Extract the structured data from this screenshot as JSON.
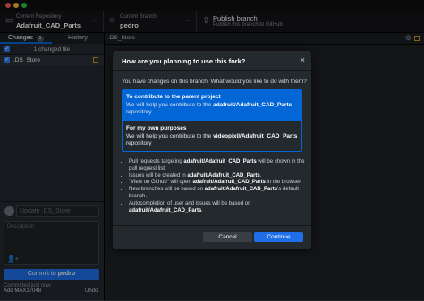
{
  "window": {
    "traffic_lights": [
      "#ff5f57",
      "#febc2e",
      "#28c840"
    ]
  },
  "toolbar": {
    "repo_label": "Current Repository",
    "repo_name": "Adafruit_CAD_Parts",
    "branch_label": "Current Branch",
    "branch_name": "pedro",
    "publish_label": "Publish branch",
    "publish_sub": "Publish this branch to GitHub"
  },
  "sidebar": {
    "tabs": [
      {
        "label": "Changes",
        "badge": "1"
      },
      {
        "label": "History"
      }
    ],
    "changes_count": "1 changed file",
    "files": [
      {
        "name": ".DS_Store",
        "status": "modified"
      }
    ],
    "commit": {
      "summary_placeholder": "Update .DS_Store",
      "description_placeholder": "Description",
      "commit_button_prefix": "Commit to ",
      "commit_branch": "pedro",
      "last_commit_line1": "Committed just now",
      "last_commit_line2": "Add MAX17048",
      "undo": "Undo"
    }
  },
  "main": {
    "file_title": ".DS_Store"
  },
  "modal": {
    "title": "How are you planning to use this fork?",
    "intro": "You have changes on this branch. What would you like to do with them?",
    "options": [
      {
        "title": "To contribute to the parent project",
        "desc_prefix": "We will help you contribute to the ",
        "repo": "adafruit/Adafruit_CAD_Parts",
        "desc_suffix": "repository",
        "selected": true
      },
      {
        "title": "For my own purposes",
        "desc_prefix": "We will help you contribute to the ",
        "repo": "videopixil/Adafruit_CAD_Parts",
        "desc_suffix": "repository",
        "selected": false
      }
    ],
    "bullets": [
      {
        "pre": "Pull requests targeting ",
        "bold": "adafruit/Adafruit_CAD_Parts",
        "post": " will be shown in the pull request list."
      },
      {
        "pre": "Issues will be created in ",
        "bold": "adafruit/Adafruit_CAD_Parts",
        "post": "."
      },
      {
        "pre": "\"View on Github\" will open ",
        "bold": "adafruit/Adafruit_CAD_Parts",
        "post": " in the browser."
      },
      {
        "pre": "New branches will be based on ",
        "bold": "adafruit/Adafruit_CAD_Parts",
        "post": "'s default branch."
      },
      {
        "pre": "Autocompletion of user and issues will be based on ",
        "bold": "adafruit/Adafruit_CAD_Parts",
        "post": "."
      }
    ],
    "cancel_label": "Cancel",
    "continue_label": "Continue"
  }
}
